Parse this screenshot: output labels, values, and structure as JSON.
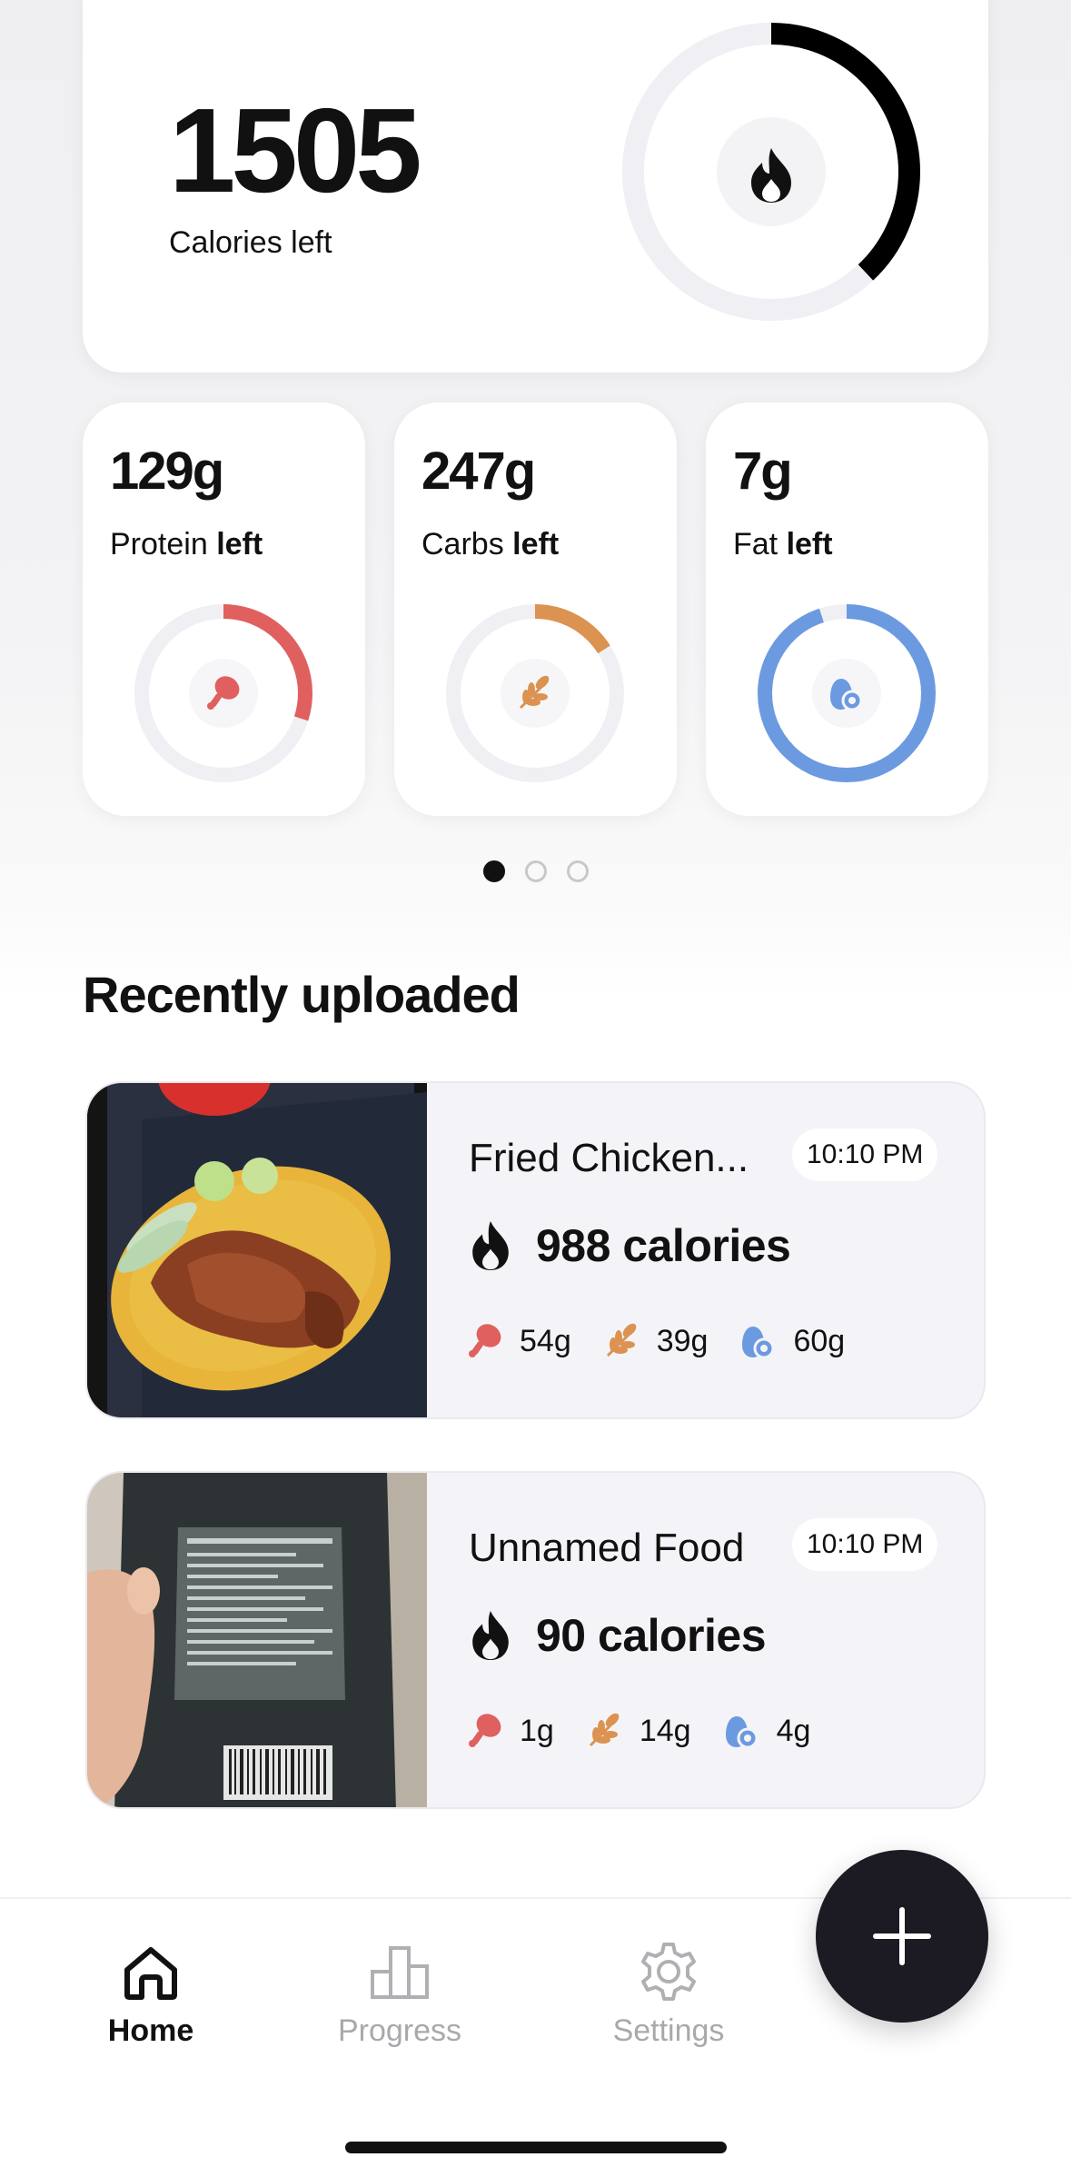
{
  "summary": {
    "calories_left": "1505",
    "calories_label": "Calories left",
    "calories_progress": 0.38
  },
  "macros": [
    {
      "amount": "129g",
      "label": "Protein",
      "suffix": "left",
      "color": "#e0605f",
      "icon": "drumstick-icon",
      "progress": 0.3
    },
    {
      "amount": "247g",
      "label": "Carbs",
      "suffix": "left",
      "color": "#dc9251",
      "icon": "wheat-icon",
      "progress": 0.16
    },
    {
      "amount": "7g",
      "label": "Fat",
      "suffix": "left",
      "color": "#6c9ae0",
      "icon": "avocado-icon",
      "progress": 0.95
    }
  ],
  "pager": {
    "count": 3,
    "active": 0
  },
  "recent": {
    "title": "Recently uploaded",
    "items": [
      {
        "name": "Fried Chicken...",
        "time": "10:10 PM",
        "calories": "988 calories",
        "protein": "54g",
        "carbs": "39g",
        "fat": "60g"
      },
      {
        "name": "Unnamed Food",
        "time": "10:10 PM",
        "calories": "90 calories",
        "protein": "1g",
        "carbs": "14g",
        "fat": "4g"
      }
    ]
  },
  "nav": {
    "home": "Home",
    "progress": "Progress",
    "settings": "Settings"
  },
  "colors": {
    "accent": "#111111",
    "protein": "#e0605f",
    "carbs": "#dc9251",
    "fat": "#6c9ae0",
    "track": "#efeff4",
    "fab": "#1c1a23"
  }
}
